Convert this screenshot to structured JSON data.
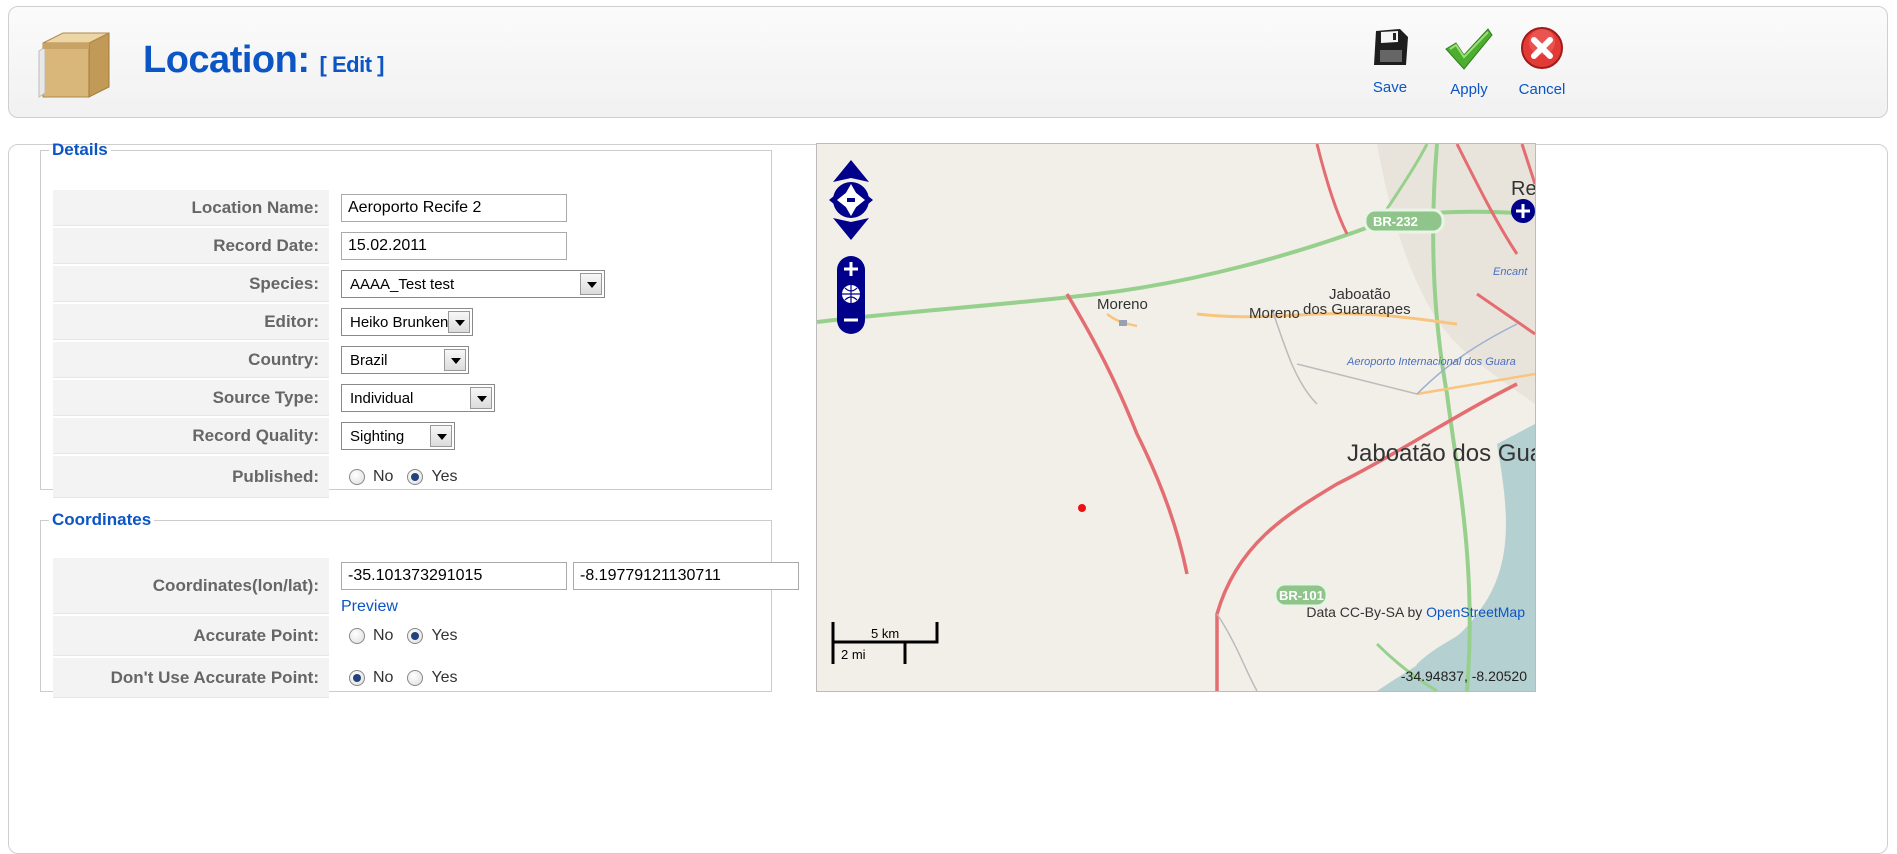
{
  "header": {
    "title": "Location:",
    "edit_label": "[ Edit ]",
    "toolbar": {
      "save_label": "Save",
      "apply_label": "Apply",
      "cancel_label": "Cancel"
    }
  },
  "details": {
    "legend": "Details",
    "location_name": {
      "label": "Location Name:",
      "value": "Aeroporto Recife 2"
    },
    "record_date": {
      "label": "Record Date:",
      "value": "15.02.2011"
    },
    "species": {
      "label": "Species:",
      "value": "AAAA_Test test"
    },
    "editor": {
      "label": "Editor:",
      "value": "Heiko Brunken"
    },
    "country": {
      "label": "Country:",
      "value": "Brazil"
    },
    "source_type": {
      "label": "Source Type:",
      "value": "Individual"
    },
    "record_quality": {
      "label": "Record Quality:",
      "value": "Sighting"
    },
    "published": {
      "label": "Published:",
      "no": "No",
      "yes": "Yes",
      "selected": "Yes"
    }
  },
  "coordinates": {
    "legend": "Coordinates",
    "coords": {
      "label": "Coordinates(lon/lat):",
      "lon": "-35.101373291015",
      "lat": "-8.19779121130711",
      "preview": "Preview"
    },
    "accurate_point": {
      "label": "Accurate Point:",
      "no": "No",
      "yes": "Yes",
      "selected": "Yes"
    },
    "dont_use_accurate_point": {
      "label": "Don't Use Accurate Point:",
      "no": "No",
      "yes": "Yes",
      "selected": "No"
    }
  },
  "map": {
    "places": {
      "re": "Re",
      "moreno_1": "Moreno",
      "moreno_2": "Moreno",
      "jaboatao_line1": "Jaboatão",
      "jaboatao_line2": "dos Guararapes",
      "airport": "Aeroporto Internacional dos Guara",
      "jaboatao_big": "Jaboatão dos Guar",
      "encant": "Encant"
    },
    "roads": {
      "br232": "BR-232",
      "br101": "BR-101"
    },
    "scale": {
      "km": "5 km",
      "mi": "2 mi"
    },
    "attribution": {
      "prefix": "Data CC-By-SA by",
      "link": "OpenStreetMap"
    },
    "mouse_position": "-34.94837, -8.20520",
    "colors": {
      "land": "#f2efe9",
      "water": "#b5d0d0",
      "trunk": "#97d08d",
      "primary": "#e46d71",
      "secondary": "#f9c57e",
      "control": "#00008b"
    }
  }
}
